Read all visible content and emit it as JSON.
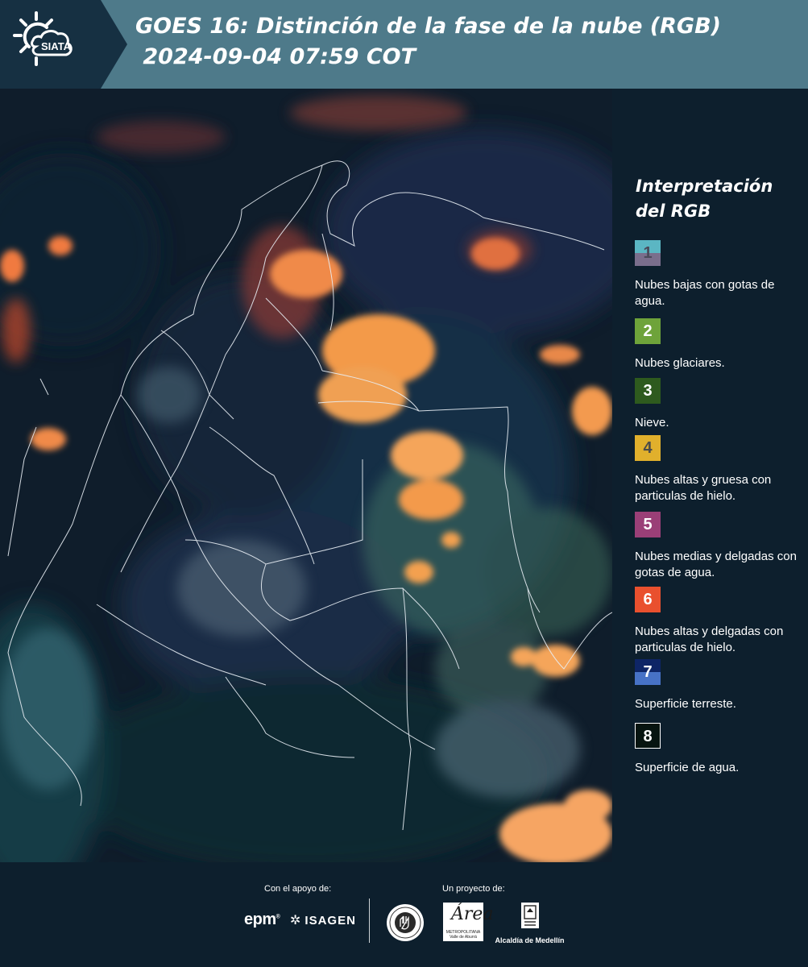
{
  "header": {
    "logo_text": "SIATA",
    "title_line1": "GOES 16: Distinción de la fase de la nube (RGB)",
    "title_line2": " 2024-09-04 07:59 COT"
  },
  "legend": {
    "title_line1": "Interpretación",
    "title_line2": "del RGB",
    "items": [
      {
        "number": "1",
        "label": "Nubes bajas con gotas de agua.",
        "color_top": "#5bb6c3",
        "color_bottom": "#7a6e8c",
        "text_color": "#4a4a5a"
      },
      {
        "number": "2",
        "label": "Nubes glaciares.",
        "color_top": "#6ea33a",
        "color_bottom": "#6ea33a",
        "text_color": "#ffffff"
      },
      {
        "number": "3",
        "label": "Nieve.",
        "color_top": "#2e5a1e",
        "color_bottom": "#2e5a1e",
        "text_color": "#ffffff"
      },
      {
        "number": "4",
        "label": "Nubes altas y gruesa con particulas de hielo.",
        "color_top": "#e1b02c",
        "color_bottom": "#e1b02c",
        "text_color": "#4a4a4a"
      },
      {
        "number": "5",
        "label": "Nubes medias y delgadas con gotas de agua.",
        "color_top": "#9a3f77",
        "color_bottom": "#9a3f77",
        "text_color": "#ffffff"
      },
      {
        "number": "6",
        "label": "Nubes altas y delgadas con particulas de hielo.",
        "color_top": "#e9502e",
        "color_bottom": "#e9502e",
        "text_color": "#ffffff"
      },
      {
        "number": "7",
        "label": "Superficie terreste.",
        "color_top": "#0e2566",
        "color_bottom": "#4772c6",
        "text_color": "#ffffff"
      },
      {
        "number": "8",
        "label": "Superficie de agua.",
        "color_top": "#071410",
        "color_bottom": "#071410",
        "text_color": "#ffffff"
      }
    ]
  },
  "footer": {
    "support_caption": "Con el apoyo de:",
    "project_caption": "Un proyecto de:",
    "epm_logo": "epm",
    "isagen_logo": "ISAGEN",
    "area_logo_text": "Área",
    "area_logo_subtext": "METROPOLITANA Valle de Aburrá",
    "alcaldia_label": "Alcaldía de Medellín"
  },
  "colors": {
    "header_bg": "#4e7a8a",
    "logo_bg": "#163042",
    "panel_bg": "#0d1f2d"
  }
}
